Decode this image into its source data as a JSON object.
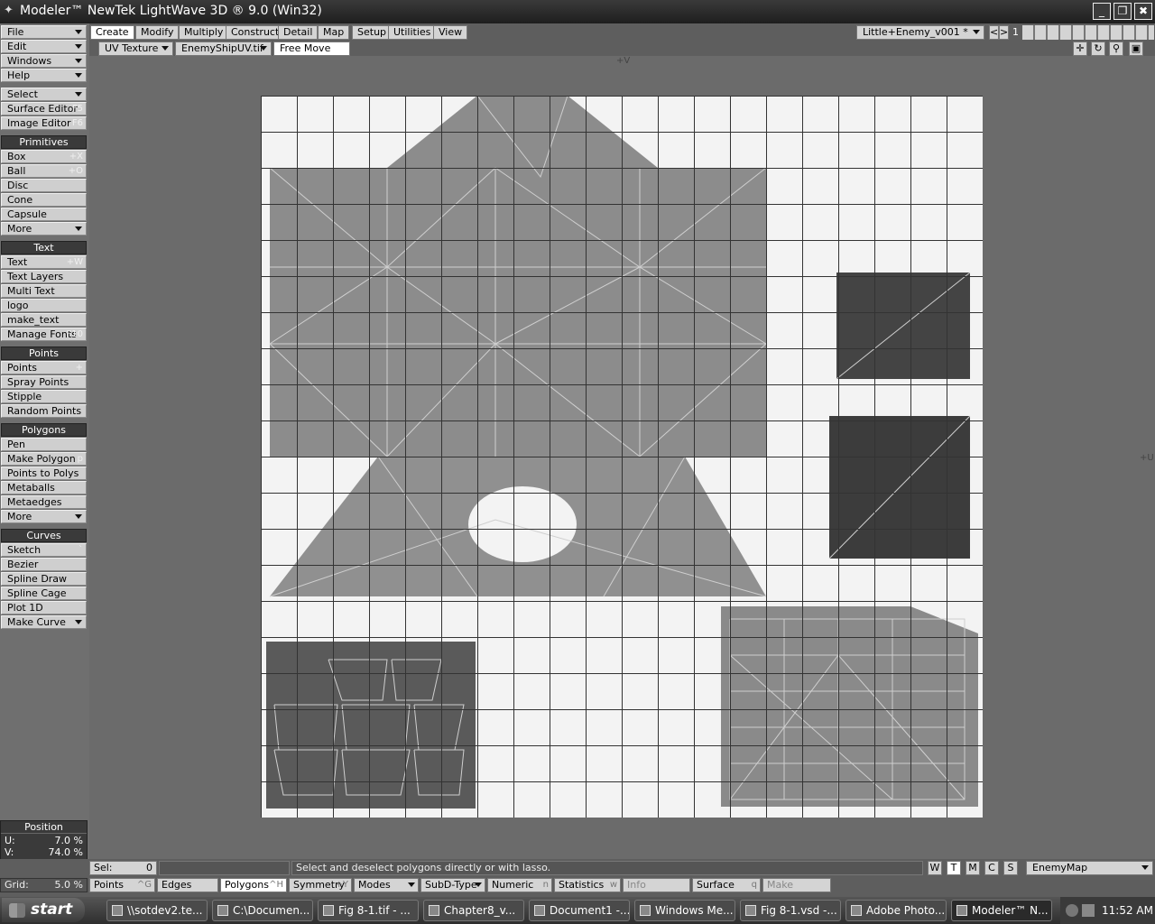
{
  "window": {
    "title": "Modeler™ NewTek LightWave 3D ® 9.0 (Win32)",
    "logo": "✦"
  },
  "window_buttons": {
    "minimize": "_",
    "restore": "❐",
    "close": "✖"
  },
  "menu": {
    "top": [
      {
        "label": "File",
        "dropdown": true
      },
      {
        "label": "Edit",
        "dropdown": true
      },
      {
        "label": "Windows",
        "dropdown": true
      },
      {
        "label": "Help",
        "dropdown": true
      }
    ],
    "tools": [
      {
        "label": "Select",
        "dropdown": true
      },
      {
        "label": "Surface Editor",
        "shortcut": "F5"
      },
      {
        "label": "Image Editor",
        "shortcut": "F6"
      }
    ],
    "groups": [
      {
        "header": "Primitives",
        "items": [
          {
            "label": "Box",
            "shortcut": "+X"
          },
          {
            "label": "Ball",
            "shortcut": "+O"
          },
          {
            "label": "Disc",
            "shortcut": ""
          },
          {
            "label": "Cone",
            "shortcut": ""
          },
          {
            "label": "Capsule",
            "shortcut": ""
          },
          {
            "label": "More",
            "dropdown": true
          }
        ]
      },
      {
        "header": "Text",
        "items": [
          {
            "label": "Text",
            "shortcut": "+W"
          },
          {
            "label": "Text Layers",
            "shortcut": ""
          },
          {
            "label": "Multi Text",
            "shortcut": ""
          },
          {
            "label": "logo",
            "shortcut": ""
          },
          {
            "label": "make_text",
            "shortcut": ""
          },
          {
            "label": "Manage Fonts",
            "shortcut": "F10"
          }
        ]
      },
      {
        "header": "Points",
        "items": [
          {
            "label": "Points",
            "shortcut": "+"
          },
          {
            "label": "Spray Points",
            "shortcut": ""
          },
          {
            "label": "Stipple",
            "shortcut": ""
          },
          {
            "label": "Random Points",
            "shortcut": ""
          }
        ]
      },
      {
        "header": "Polygons",
        "items": [
          {
            "label": "Pen",
            "shortcut": ""
          },
          {
            "label": "Make Polygon",
            "shortcut": "p"
          },
          {
            "label": "Points to Polys",
            "shortcut": ""
          },
          {
            "label": "Metaballs",
            "shortcut": ""
          },
          {
            "label": "Metaedges",
            "shortcut": ""
          },
          {
            "label": "More",
            "dropdown": true
          }
        ]
      },
      {
        "header": "Curves",
        "items": [
          {
            "label": "Sketch",
            "shortcut": "`"
          },
          {
            "label": "Bezier",
            "shortcut": ""
          },
          {
            "label": "Spline Draw",
            "shortcut": ""
          },
          {
            "label": "Spline Cage",
            "shortcut": ""
          },
          {
            "label": "Plot 1D",
            "shortcut": ""
          },
          {
            "label": "Make Curve",
            "dropdown": true
          }
        ]
      }
    ]
  },
  "position": {
    "header": "Position",
    "u_label": "U:",
    "u_value": "7.0 %",
    "v_label": "V:",
    "v_value": "74.0 %"
  },
  "grid": {
    "label": "Grid:",
    "value": "5.0 %"
  },
  "tabs": [
    "Create",
    "Modify",
    "Multiply",
    "Construct",
    "Detail",
    "Map",
    "Setup",
    "Utilities",
    "View"
  ],
  "selected_tab": "Create",
  "layer_combo": "Little+Enemy_v001 *",
  "layer_number": "1",
  "nav": {
    "prev": "<",
    "next": ">"
  },
  "viewport_bar": {
    "map_type": "UV Texture",
    "image": "EnemyShipUV.tif",
    "mode": "Free Move"
  },
  "viewport_icons": {
    "move": "✛",
    "rotate": "↻",
    "zoom": "⚲",
    "maximize": "▣"
  },
  "axis_labels": {
    "v": "+V",
    "u": "+U"
  },
  "status": {
    "sel_label": "Sel:",
    "sel_value": "0",
    "message": "Select and deselect polygons directly or with lasso."
  },
  "view_modes": [
    "W",
    "T",
    "M",
    "C",
    "S"
  ],
  "selected_view_mode": "T",
  "map_combo": "EnemyMap",
  "bottom_buttons": [
    {
      "label": "Points",
      "shortcut": "^G"
    },
    {
      "label": "Edges",
      "shortcut": ""
    },
    {
      "label": "Polygons",
      "shortcut": "^H"
    },
    {
      "label": "Symmetry",
      "shortcut": "+Y"
    },
    {
      "label": "Modes",
      "dropdown": true
    },
    {
      "label": "SubD-Type",
      "dropdown": true
    },
    {
      "label": "Numeric",
      "shortcut": "n"
    },
    {
      "label": "Statistics",
      "shortcut": "w"
    },
    {
      "label": "Info",
      "shortcut": ""
    },
    {
      "label": "Surface",
      "shortcut": "q"
    },
    {
      "label": "Make",
      "shortcut": ""
    }
  ],
  "taskbar": {
    "start": "start",
    "items": [
      "\\\\sotdev2.te...",
      "C:\\Documen...",
      "Fig 8-1.tif - ...",
      "Chapter8_v...",
      "Document1 -...",
      "Windows Me...",
      "Fig 8-1.vsd -...",
      "Adobe Photo...",
      "Modeler™ N..."
    ],
    "clock": "11:52 AM"
  }
}
